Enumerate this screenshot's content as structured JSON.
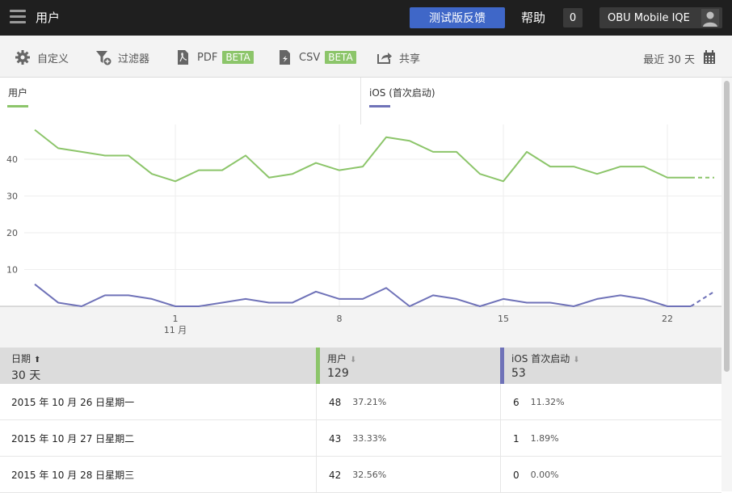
{
  "topbar": {
    "title": "用户",
    "feedback_label": "测试版反馈",
    "help_label": "帮助",
    "notification_count": "0",
    "account_label": "OBU Mobile IQE"
  },
  "toolbar": {
    "customize_label": "自定义",
    "filter_label": "过滤器",
    "pdf_label": "PDF",
    "pdf_badge": "BETA",
    "csv_label": "CSV",
    "csv_badge": "BETA",
    "share_label": "共享",
    "date_range_label": "最近 30 天"
  },
  "colors": {
    "users": "#8cc56a",
    "ios": "#6f72b8",
    "accent_button": "#3f67c8"
  },
  "chart_data": {
    "type": "line",
    "x_ticks": [
      "1",
      "8",
      "15",
      "22"
    ],
    "x_month_label": "11 月",
    "y_ticks": [
      "10",
      "20",
      "30",
      "40"
    ],
    "ylim": [
      0,
      50
    ],
    "series": [
      {
        "name": "用户",
        "values": [
          48,
          43,
          42,
          41,
          41,
          36,
          34,
          37,
          37,
          41,
          35,
          36,
          39,
          37,
          38,
          46,
          45,
          42,
          42,
          36,
          34,
          42,
          38,
          38,
          36,
          38,
          38,
          35,
          35,
          35
        ],
        "projected_from": 28
      },
      {
        "name": "iOS (首次启动)",
        "values": [
          6,
          1,
          0,
          3,
          3,
          2,
          0,
          0,
          1,
          2,
          1,
          1,
          4,
          2,
          2,
          5,
          0,
          3,
          2,
          0,
          2,
          1,
          1,
          0,
          2,
          3,
          2,
          0,
          0,
          4
        ],
        "projected_from": 28
      }
    ]
  },
  "legend": {
    "users": "用户",
    "ios": "iOS (首次启动)"
  },
  "table": {
    "headers": [
      {
        "label": "日期",
        "sort": "⬆",
        "sub": "30 天"
      },
      {
        "label": "用户",
        "sort": "⬇",
        "sub": "129"
      },
      {
        "label": "iOS 首次启动",
        "sort": "⬇",
        "sub": "53"
      }
    ],
    "rows": [
      {
        "date": "2015 年 10 月 26 日星期一",
        "users": "48",
        "users_pct": "37.21%",
        "ios": "6",
        "ios_pct": "11.32%"
      },
      {
        "date": "2015 年 10 月 27 日星期二",
        "users": "43",
        "users_pct": "33.33%",
        "ios": "1",
        "ios_pct": "1.89%"
      },
      {
        "date": "2015 年 10 月 28 日星期三",
        "users": "42",
        "users_pct": "32.56%",
        "ios": "0",
        "ios_pct": "0.00%"
      }
    ]
  }
}
